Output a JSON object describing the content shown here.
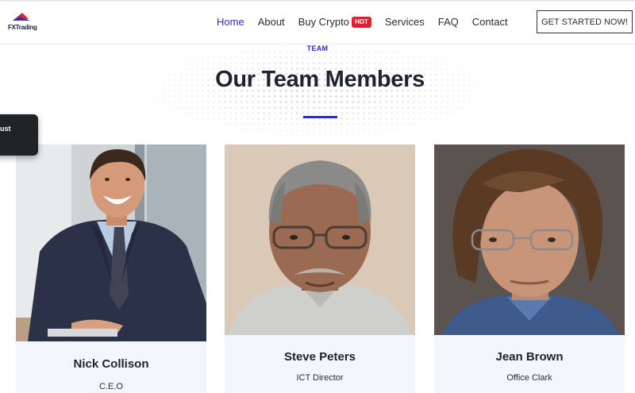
{
  "brand": {
    "logo_text": "FXTrading"
  },
  "nav": {
    "items": [
      {
        "label": "Home"
      },
      {
        "label": "About"
      },
      {
        "label": "Buy Crypto",
        "badge": "HOT"
      },
      {
        "label": "Services"
      },
      {
        "label": "FAQ"
      },
      {
        "label": "Contact"
      }
    ],
    "cta_label": "GET STARTED NOW!"
  },
  "colors": {
    "accent": "#2d2fb8",
    "badge": "#e0202f",
    "card_bg": "#f3f6fb"
  },
  "side_toast": {
    "text": "ust"
  },
  "section": {
    "eyebrow": "TEAM",
    "title": "Our Team Members"
  },
  "team": [
    {
      "name": "Nick Collison",
      "role": "C.E.O"
    },
    {
      "name": "Steve Peters",
      "role": "ICT Director"
    },
    {
      "name": "Jean Brown",
      "role": "Office Clark"
    }
  ]
}
